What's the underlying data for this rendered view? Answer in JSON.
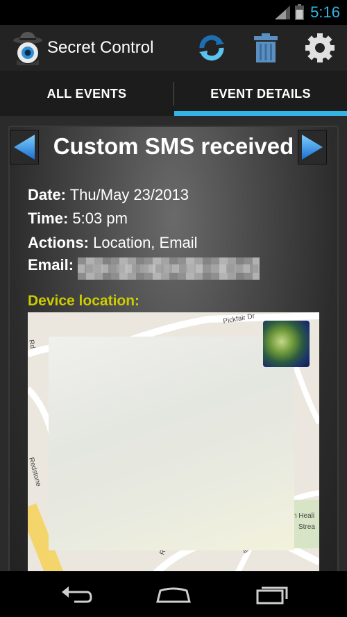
{
  "status_bar": {
    "time": "5:16",
    "signal_icon": "signal-icon",
    "battery_icon": "battery-icon",
    "accent": "#33b5e5"
  },
  "action_bar": {
    "app_title": "Secret Control",
    "logo_icon": "spy-eye-logo-icon",
    "actions": [
      {
        "name": "refresh",
        "icon": "refresh-icon"
      },
      {
        "name": "delete",
        "icon": "trash-icon"
      },
      {
        "name": "settings",
        "icon": "gear-icon"
      }
    ]
  },
  "tabs": {
    "items": [
      {
        "label": "ALL EVENTS",
        "selected": false
      },
      {
        "label": "EVENT DETAILS",
        "selected": true
      }
    ],
    "indicator_color": "#33b5e5"
  },
  "event": {
    "title": "Custom SMS received",
    "fields": {
      "date_label": "Date:",
      "date_value": "Thu/May 23/2013",
      "time_label": "Time:",
      "time_value": "5:03 pm",
      "actions_label": "Actions:",
      "actions_value": "Location, Email",
      "email_label": "Email:"
    },
    "location_label": "Device location:",
    "location_label_color": "#cccc00"
  },
  "map": {
    "streets": [
      "Pickfair Dr",
      "Rd",
      "Redstone",
      "Rd",
      "anion Rd",
      "n Heali",
      "Strea"
    ]
  },
  "nav_bar": {
    "back_icon": "back-icon",
    "home_icon": "home-icon",
    "recent_icon": "recent-apps-icon"
  }
}
